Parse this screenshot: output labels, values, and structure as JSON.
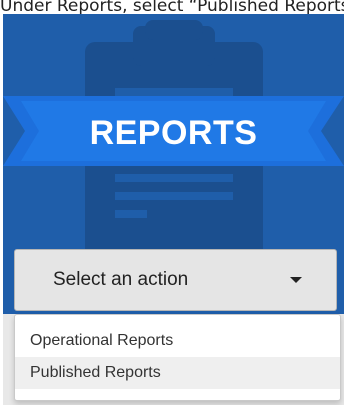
{
  "instruction": {
    "text": "Under Reports, select “Published Reports”"
  },
  "tile": {
    "title": "REPORTS",
    "background_color": "#1f5eaa",
    "ribbon_color": "#1a73e8",
    "icon": "clipboard-icon"
  },
  "action_select": {
    "label": "Select an action",
    "icon": "caret-down-icon"
  },
  "menu": {
    "items": [
      {
        "label": "Operational Reports"
      },
      {
        "label": "Published Reports",
        "highlighted": true
      }
    ]
  }
}
